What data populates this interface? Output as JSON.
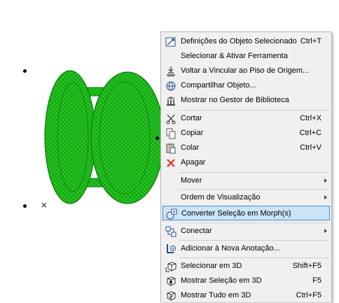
{
  "menu": {
    "items": {
      "obj_settings": {
        "label": "Definições do Objeto Selecionado",
        "shortcut": "Ctrl+T",
        "icon": "object-settings-icon"
      },
      "select_activate": {
        "label": "Selecionar & Ativar Ferramenta",
        "shortcut": ""
      },
      "relink_floor": {
        "label": "Voltar a Vincular ao Piso de Origem...",
        "shortcut": "",
        "icon": "relink-floor-icon"
      },
      "share_object": {
        "label": "Compartilhar Objeto...",
        "shortcut": "",
        "icon": "globe-icon"
      },
      "show_library": {
        "label": "Mostrar no Gestor de Biblioteca",
        "shortcut": "",
        "icon": "library-icon"
      },
      "cut": {
        "label": "Cortar",
        "shortcut": "Ctrl+X",
        "icon": "scissors-icon"
      },
      "copy": {
        "label": "Copiar",
        "shortcut": "Ctrl+C",
        "icon": "copy-icon"
      },
      "paste": {
        "label": "Colar",
        "shortcut": "Ctrl+V",
        "icon": "paste-icon"
      },
      "delete": {
        "label": "Apagar",
        "shortcut": "",
        "icon": "delete-x-icon"
      },
      "move": {
        "label": "Mover",
        "submenu": true
      },
      "display_order": {
        "label": "Ordem de Visualização",
        "submenu": true
      },
      "convert_morph": {
        "label": "Converter Seleção em Morph(s)",
        "shortcut": "",
        "icon": "morph-convert-icon",
        "highlighted": true
      },
      "connect": {
        "label": "Conectar",
        "submenu": true,
        "icon": "connect-icon"
      },
      "add_annotation": {
        "label": "Adicionar à Nova Anotação...",
        "shortcut": "",
        "icon": "annotation-icon"
      },
      "select_3d": {
        "label": "Selecionar em 3D",
        "shortcut": "Shift+F5",
        "icon": "cube-select-icon"
      },
      "show_sel_3d": {
        "label": "Mostrar Seleção em 3D",
        "shortcut": "F5",
        "icon": "cube-show-icon"
      },
      "show_all_3d": {
        "label": "Mostrar Tudo em 3D",
        "shortcut": "Ctrl+F5",
        "icon": "cube-all-icon"
      }
    }
  },
  "colors": {
    "chair": "#22c41e",
    "chair_line": "#0c7a0c",
    "highlight_bg": "#cce4f7",
    "highlight_border": "#3c8fd6",
    "menu_bg": "#f0f0f0"
  }
}
